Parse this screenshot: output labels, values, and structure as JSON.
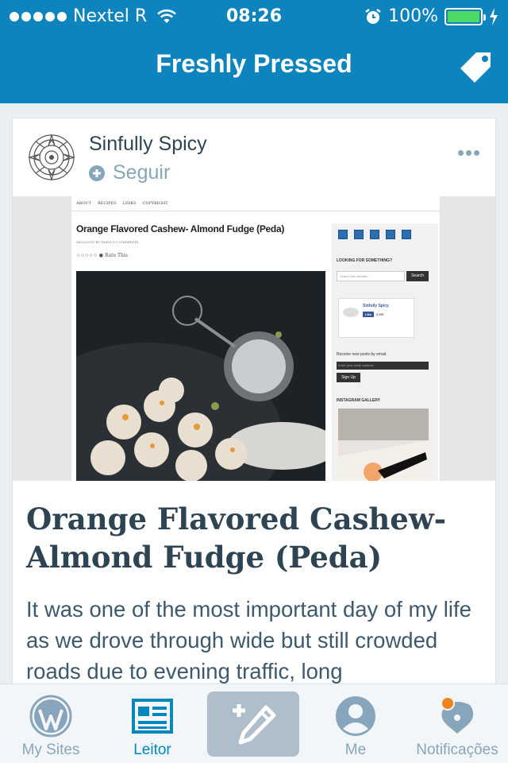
{
  "status_bar": {
    "carrier": "Nextel R",
    "time": "08:26",
    "battery": "100%",
    "signal_dots": 5,
    "icons": [
      "wifi-icon",
      "alarm-icon",
      "battery-icon",
      "charging-icon"
    ]
  },
  "nav": {
    "title": "Freshly Pressed",
    "right_icon": "tag-icon"
  },
  "card": {
    "author": "Sinfully Spicy",
    "follow_label": "Seguir",
    "more_icon": "ellipsis-icon",
    "post_title": "Orange Flavored Cashew-Almond Fudge (Peda)",
    "excerpt": "It was one of the most important day of my life as we drove through wide but still crowded roads due to evening traffic, long",
    "featured_image": {
      "menu": [
        "ABOUT",
        "RECIPES",
        "LINKS",
        "COPYRIGHT"
      ],
      "post_title": "Orange Flavored Cashew- Almond Fudge (Peda)",
      "meta": "04/22/2015 BY TANVI   10 COMMENTS",
      "rate": "Rate This",
      "side_search_heading": "LOOKING FOR SOMETHING?",
      "search_placeholder": "Search this website...",
      "search_button": "Search",
      "fb_name": "Sinfully Spicy",
      "fb_like": "Like",
      "fb_count": "2,997",
      "email_text": "Receive new posts by email.",
      "email_placeholder": "Enter your email address",
      "signup": "Sign Up",
      "instagram_heading": "INSTAGRAM GALLERY"
    }
  },
  "tabs": [
    {
      "label": "My Sites",
      "icon": "wordpress-icon",
      "active": false
    },
    {
      "label": "Leitor",
      "icon": "reader-icon",
      "active": true
    },
    {
      "label": "",
      "icon": "new-post-icon",
      "active": false
    },
    {
      "label": "Me",
      "icon": "profile-icon",
      "active": false
    },
    {
      "label": "Notificações",
      "icon": "notifications-icon",
      "active": false
    }
  ],
  "colors": {
    "header": "#0e84bf",
    "active_tab": "#0087be",
    "inactive_tab": "#87a6bc",
    "title_text": "#2e4453",
    "notification_dot": "#f0821e"
  }
}
